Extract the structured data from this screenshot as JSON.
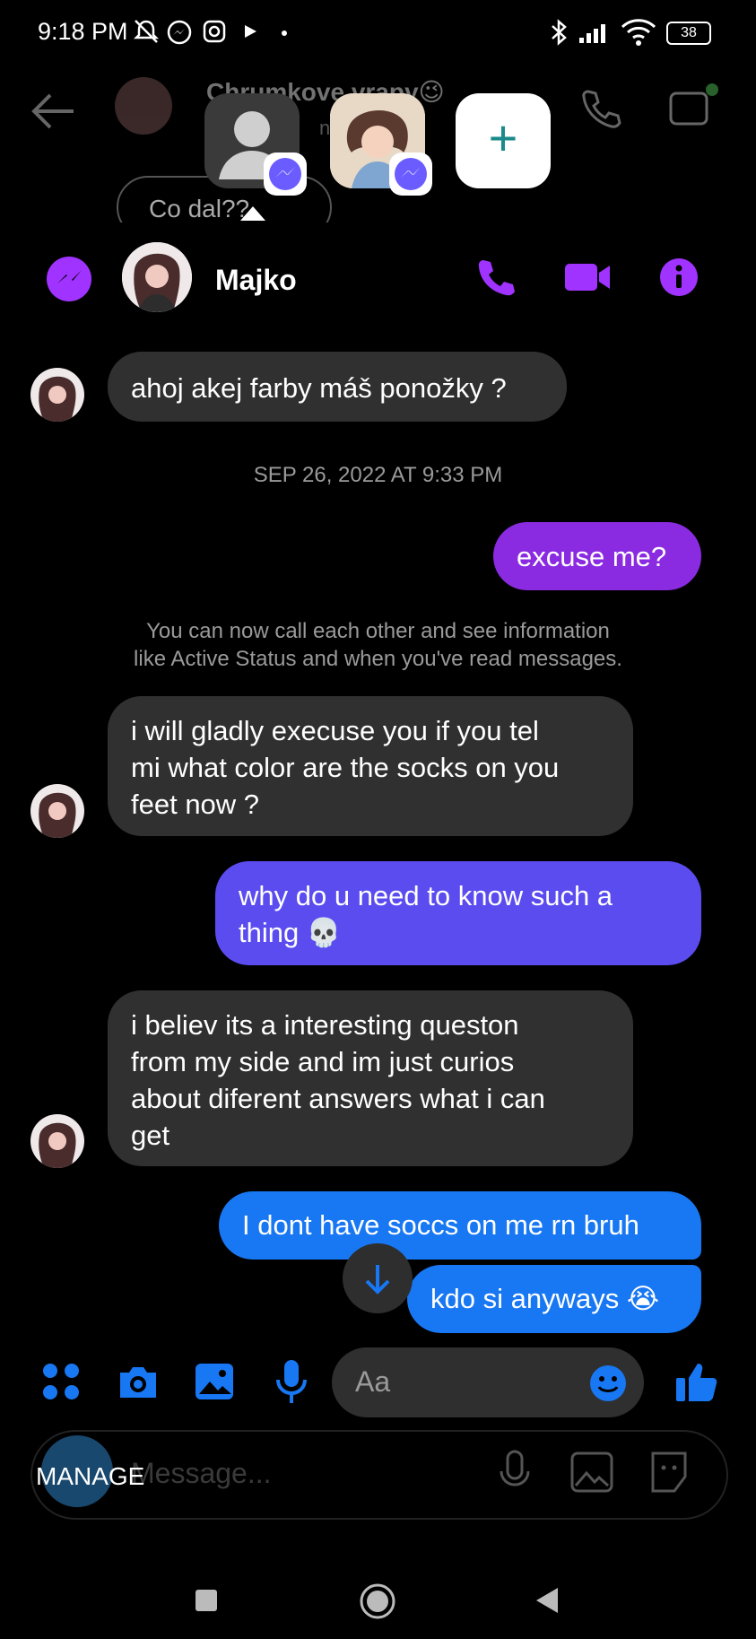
{
  "status_bar": {
    "time": "9:18 PM",
    "battery": "38"
  },
  "background_chat": {
    "title": "Chrumkove vrapy😉",
    "subtitle": "now",
    "bubble_text": "Co dal??"
  },
  "panel": {
    "contact_name": "Majko"
  },
  "messages": {
    "m1": "ahoj akej farby máš ponožky ?",
    "timestamp": "SEP 26, 2022 AT 9:33 PM",
    "m2": "excuse me?",
    "notice_line1": "You can now call each other and see information",
    "notice_line2": "like Active Status and when you've read messages.",
    "m3_l1": "i will gladly execuse you if you tel",
    "m3_l2": "mi what color are the socks on you",
    "m3_l3": "feet now ?",
    "m4_l1": "why do u need to know such a",
    "m4_l2": "thing 💀",
    "m5_l1": "i believ its a interesting queston",
    "m5_l2": "from my side and im just curios",
    "m5_l3": "about diferent answers what i can",
    "m5_l4": "get",
    "m6": "I dont have soccs on me rn bruh",
    "m7": "kdo si anyways 😭"
  },
  "composer": {
    "placeholder": "Aa"
  },
  "lower": {
    "message_placeholder": "Message...",
    "manage_label": "MANAGE"
  },
  "colors": {
    "accent_purple": "#a033ff",
    "bubble_purple": "#8a2be2",
    "bubble_indigo": "#5b4cf0",
    "bubble_blue": "#1877f2",
    "incoming_gray": "#303030"
  }
}
